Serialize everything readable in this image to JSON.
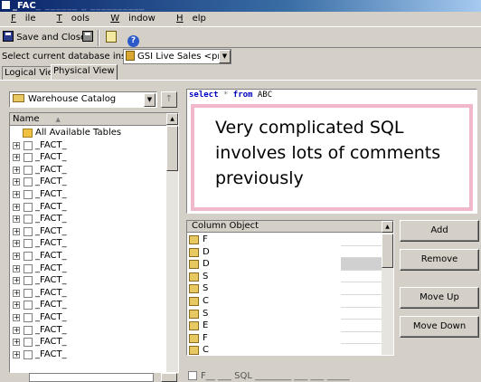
{
  "window": {
    "title_prefix": "_FAC",
    "title_rest": "_ ______ _ __________"
  },
  "menu": [
    "File",
    "Tools",
    "Window",
    "Help"
  ],
  "toolbar": {
    "save_close_label": "Save and Close"
  },
  "db": {
    "label": "Select current database instance",
    "selected": "GSI Live Sales <project"
  },
  "tabs": {
    "logical": "Logical View",
    "physical": "Physical View"
  },
  "catalog": {
    "selected": "Warehouse Catalog",
    "column_header": "Name",
    "all_tables": "All Available Tables",
    "rows": [
      "_FACT_",
      "_FACT_",
      "_FACT_",
      "_FACT_",
      "_FACT_",
      "_FACT_",
      "_FACT_",
      "_FACT_",
      "_FACT_",
      "_FACT_",
      "_FACT_",
      "_FACT_",
      "_FACT_",
      "_FACT_",
      "_FACT_",
      "_FACT_",
      "_FACT_",
      "_FACT_"
    ]
  },
  "sql": {
    "kw_select": "select",
    "star": "*",
    "kw_from": "from",
    "table": "ABC",
    "callout": "Very complicated SQL involves lots of comments previously"
  },
  "columns": {
    "header": "Column Object",
    "rows": [
      "F",
      "D",
      "D",
      "S",
      "S",
      "C",
      "S",
      "E",
      "F",
      "C"
    ],
    "selected_index": 2
  },
  "buttons": {
    "add": "Add",
    "remove": "Remove",
    "move_up": "Move Up",
    "move_down": "Move Down"
  },
  "bottom": {
    "checkbox_label": "F__ ___ SQL ________ ___ ___ _____"
  }
}
